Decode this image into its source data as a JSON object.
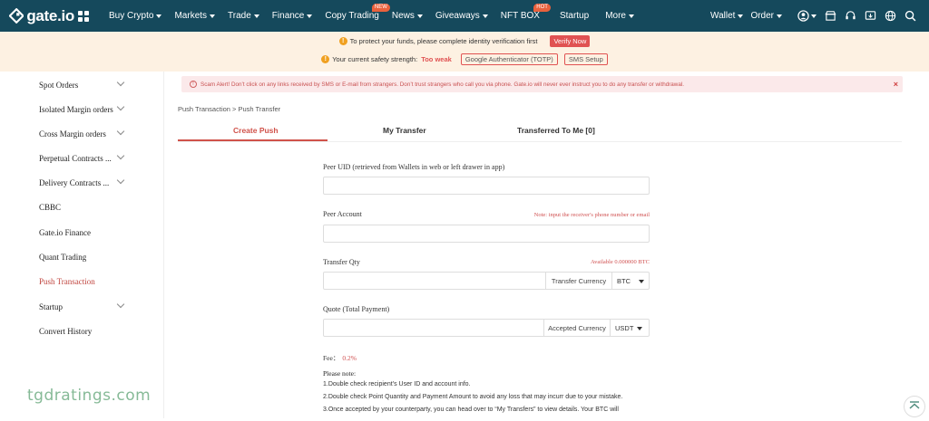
{
  "brand": {
    "name": "gate.io"
  },
  "nav": {
    "items": [
      {
        "label": "Buy Crypto",
        "caret": true
      },
      {
        "label": "Markets",
        "caret": true
      },
      {
        "label": "Trade",
        "caret": true
      },
      {
        "label": "Finance",
        "caret": true
      },
      {
        "label": "Copy Trading",
        "badge": "NEW"
      },
      {
        "label": "News",
        "caret": true
      },
      {
        "label": "Giveaways",
        "caret": true
      },
      {
        "label": "NFT BOX",
        "badge": "HOT"
      },
      {
        "label": "Startup"
      },
      {
        "label": "More",
        "caret": true
      }
    ],
    "wallet": "Wallet",
    "order": "Order"
  },
  "notice": {
    "identity_text": "To protect your funds, please complete identity verification first",
    "verify_label": "Verify Now",
    "safety_text": "Your current safety strength:",
    "safety_level": "Too weak",
    "ga_label": "Google Authenticator (TOTP)",
    "sms_label": "SMS Setup"
  },
  "sidebar": {
    "items": [
      {
        "label": "Spot Orders",
        "chevron": true
      },
      {
        "label": "Isolated Margin orders",
        "chevron": true
      },
      {
        "label": "Cross Margin orders",
        "chevron": true
      },
      {
        "label": "Perpetual Contracts ...",
        "chevron": true
      },
      {
        "label": "Delivery Contracts ...",
        "chevron": true
      },
      {
        "label": "CBBC"
      },
      {
        "label": "Gate.io Finance"
      },
      {
        "label": "Quant Trading"
      },
      {
        "label": "Push Transaction",
        "active": true
      },
      {
        "label": "Startup",
        "chevron": true
      },
      {
        "label": "Convert History"
      }
    ]
  },
  "alert": {
    "text": "Scam Alert! Don’t click on any links received by SMS or E-mail from strangers. Don’t trust strangers who call you via phone. Gate.io will never ever instruct you to do any transfer or withdrawal.",
    "close": "×"
  },
  "breadcrumb": "Push Transaction > Push Transfer",
  "tabs": [
    {
      "label": "Create Push",
      "active": true
    },
    {
      "label": "My Transfer"
    },
    {
      "label": "Transferred To Me [0]"
    }
  ],
  "form": {
    "peer_uid_label": "Peer UID (retrieved from Wallets in web or left drawer in app)",
    "peer_account_label": "Peer Account",
    "peer_account_hint": "Note: input the receiver's phone number or email",
    "qty_label": "Transfer Qty",
    "qty_available": "Available 0.000000 BTC",
    "transfer_currency_label": "Transfer Currency",
    "transfer_currency_value": "BTC",
    "quote_label": "Quote (Total Payment)",
    "accepted_currency_label": "Accepted Currency",
    "accepted_currency_value": "USDT",
    "fee_label": "Fee：",
    "fee_value": "0.2%"
  },
  "notes": {
    "title": "Please note:",
    "lines": [
      "1.Double check recipient’s User ID and account info.",
      "2.Double check Point Quantity and Payment Amount to avoid any loss that may incurr due to your mistake.",
      "3.Once accepted by your counterparty, you can head over to “My Transfers” to view details. Your BTC will"
    ]
  },
  "watermark": "tgdratings.com",
  "colors": {
    "nav_bg": "#15495c",
    "accent": "#d0524a",
    "notice_bg": "#fdf1e2"
  }
}
